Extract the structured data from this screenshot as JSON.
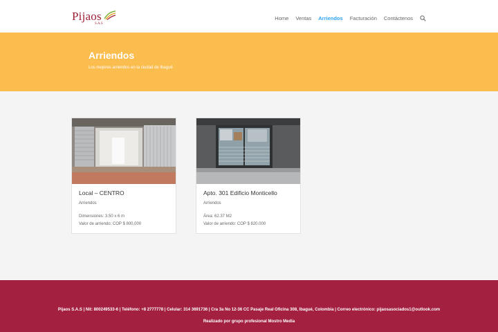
{
  "header": {
    "logo_text": "Pijaos",
    "logo_sub": "S.A.S",
    "nav": {
      "home": "Home",
      "ventas": "Ventas",
      "arriendos": "Arriendos",
      "facturacion": "Facturación",
      "contactenos": "Contáctenos"
    },
    "active_color": "#2ea3f2"
  },
  "hero": {
    "title": "Arriendos",
    "subtitle": "Los mejores arriendos en la ciudad de Ibagué",
    "background": "#fcbd4f"
  },
  "listings": [
    {
      "title": "Local – CENTRO",
      "category": "Arriendos",
      "line1": "Dimensiones: 3.50 x 6 m",
      "line2": "Valor de arriendo: COP $ 800,000"
    },
    {
      "title": "Apto. 301 Edificio Monticello",
      "category": "Arriendos",
      "line1": "Área: 62.37 M2",
      "line2": "Valor de arriendo: COP $ 820.000"
    }
  ],
  "footer": {
    "info": "Pijaos S.A.S | Nit: 800249533-6 | Teléfono: +8 2777778 | Celular: 314 3691736 | Cra 3a No 12-36 CC Pasaje Real Oficina 308, Ibagué, Colombia | Correo electrónico: pijaosasociados1@outlook.com",
    "credit": "Realizado por grupo profesional Mostro Media",
    "background": "#a32040"
  }
}
